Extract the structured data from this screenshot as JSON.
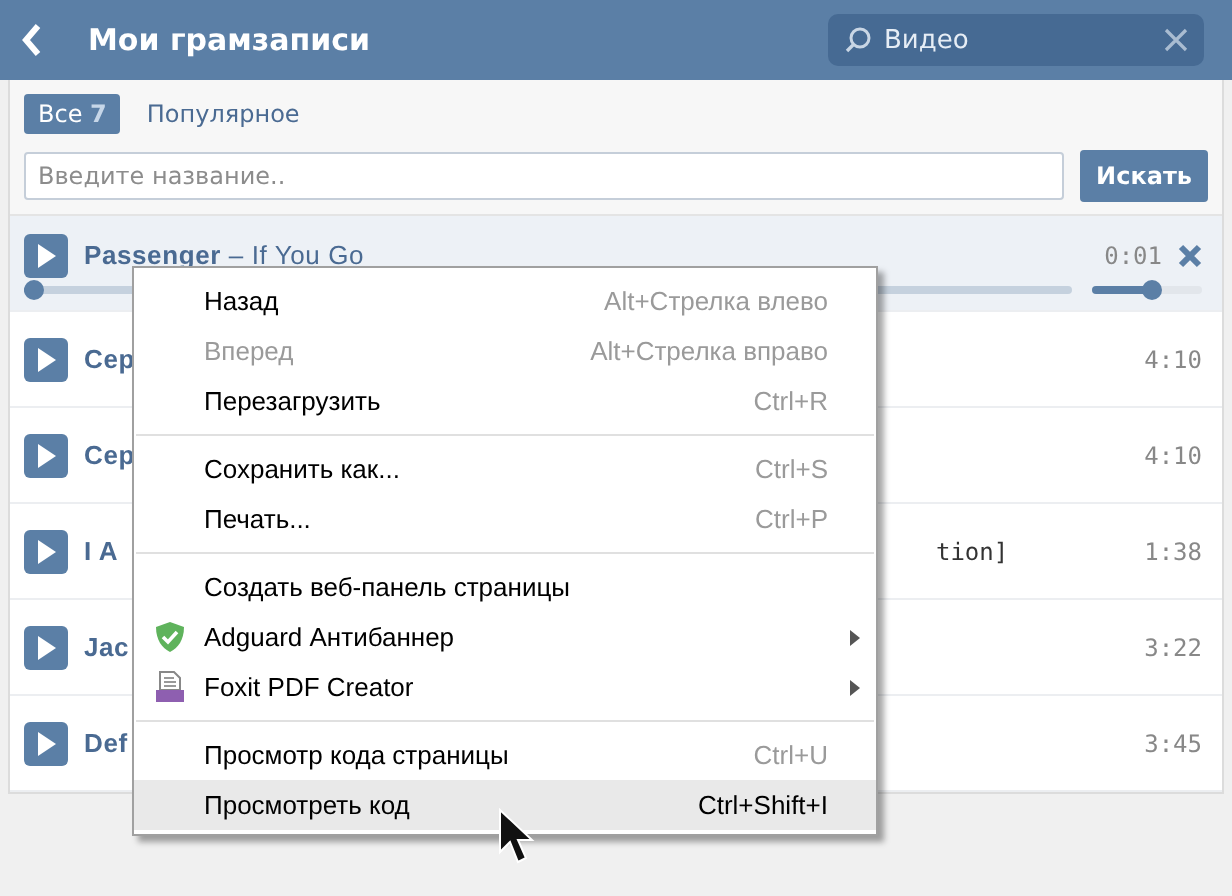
{
  "header": {
    "title": "Мои грамзаписи",
    "search": {
      "value": "Видео"
    }
  },
  "tabs": [
    {
      "label": "Все",
      "count": "7",
      "selected": true
    },
    {
      "label": "Популярное",
      "selected": false
    }
  ],
  "filter": {
    "placeholder": "Введите название..",
    "button": "Искать"
  },
  "tracks": [
    {
      "artist": "Passenger",
      "title": " – If You Go",
      "duration": "0:01",
      "playing": true,
      "level": 0.01,
      "volume": {
        "level": 0.55
      }
    },
    {
      "artist": "Сер",
      "duration": "4:10",
      "playing": false
    },
    {
      "artist": "Сер",
      "duration": "4:10",
      "playing": false
    },
    {
      "artist": "I A",
      "title_tail": "tion]",
      "duration": "1:38",
      "playing": false
    },
    {
      "artist": "Jac",
      "duration": "3:22",
      "playing": false
    },
    {
      "artist": "Def",
      "duration": "3:45",
      "playing": false
    }
  ],
  "context_menu": [
    {
      "kind": "item",
      "label": "Назад",
      "shortcut": "Alt+Стрелка влево",
      "disabled": false,
      "highlighted": false
    },
    {
      "kind": "item",
      "label": "Вперед",
      "shortcut": "Alt+Стрелка вправо",
      "disabled": true,
      "highlighted": false
    },
    {
      "kind": "item",
      "label": "Перезагрузить",
      "shortcut": "Ctrl+R",
      "disabled": false,
      "highlighted": false
    },
    {
      "kind": "separator"
    },
    {
      "kind": "item",
      "label": "Сохранить как...",
      "shortcut": "Ctrl+S",
      "disabled": false,
      "highlighted": false
    },
    {
      "kind": "item",
      "label": "Печать...",
      "shortcut": "Ctrl+P",
      "disabled": false,
      "highlighted": false
    },
    {
      "kind": "separator"
    },
    {
      "kind": "item",
      "label": "Создать веб-панель страницы",
      "disabled": false,
      "highlighted": false
    },
    {
      "kind": "submenu",
      "label": "Adguard Антибаннер",
      "disabled": false,
      "highlighted": false
    },
    {
      "kind": "submenu",
      "label": "Foxit PDF Creator",
      "disabled": false,
      "highlighted": false
    },
    {
      "kind": "separator"
    },
    {
      "kind": "item",
      "label": "Просмотр кода страницы",
      "shortcut": "Ctrl+U",
      "disabled": false,
      "highlighted": false
    },
    {
      "kind": "item",
      "label": "Просмотреть код",
      "shortcut": "Ctrl+Shift+I",
      "disabled": false,
      "highlighted": true
    }
  ]
}
